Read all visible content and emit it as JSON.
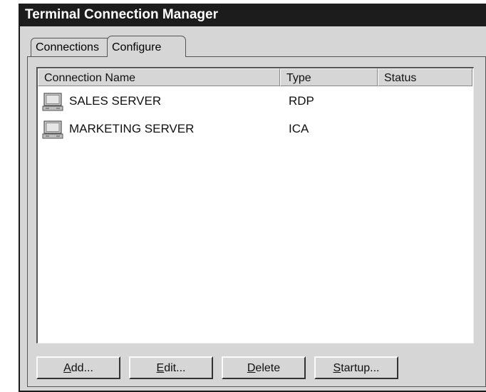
{
  "window": {
    "title": "Terminal Connection Manager"
  },
  "tabs": [
    {
      "label": "Connections"
    },
    {
      "label": "Configure",
      "selected": true
    }
  ],
  "list": {
    "columns": [
      "Connection Name",
      "Type",
      "Status"
    ],
    "rows": [
      {
        "name": "SALES SERVER",
        "type": "RDP",
        "status": "",
        "icon": "computer-icon"
      },
      {
        "name": "MARKETING SERVER",
        "type": "ICA",
        "status": "",
        "icon": "computer-icon"
      }
    ]
  },
  "buttons": {
    "add": {
      "mnemonic": "A",
      "rest": "dd..."
    },
    "edit": {
      "mnemonic": "E",
      "rest": "dit..."
    },
    "delete": {
      "mnemonic": "D",
      "rest": "elete"
    },
    "startup": {
      "mnemonic": "S",
      "rest": "tartup..."
    }
  }
}
